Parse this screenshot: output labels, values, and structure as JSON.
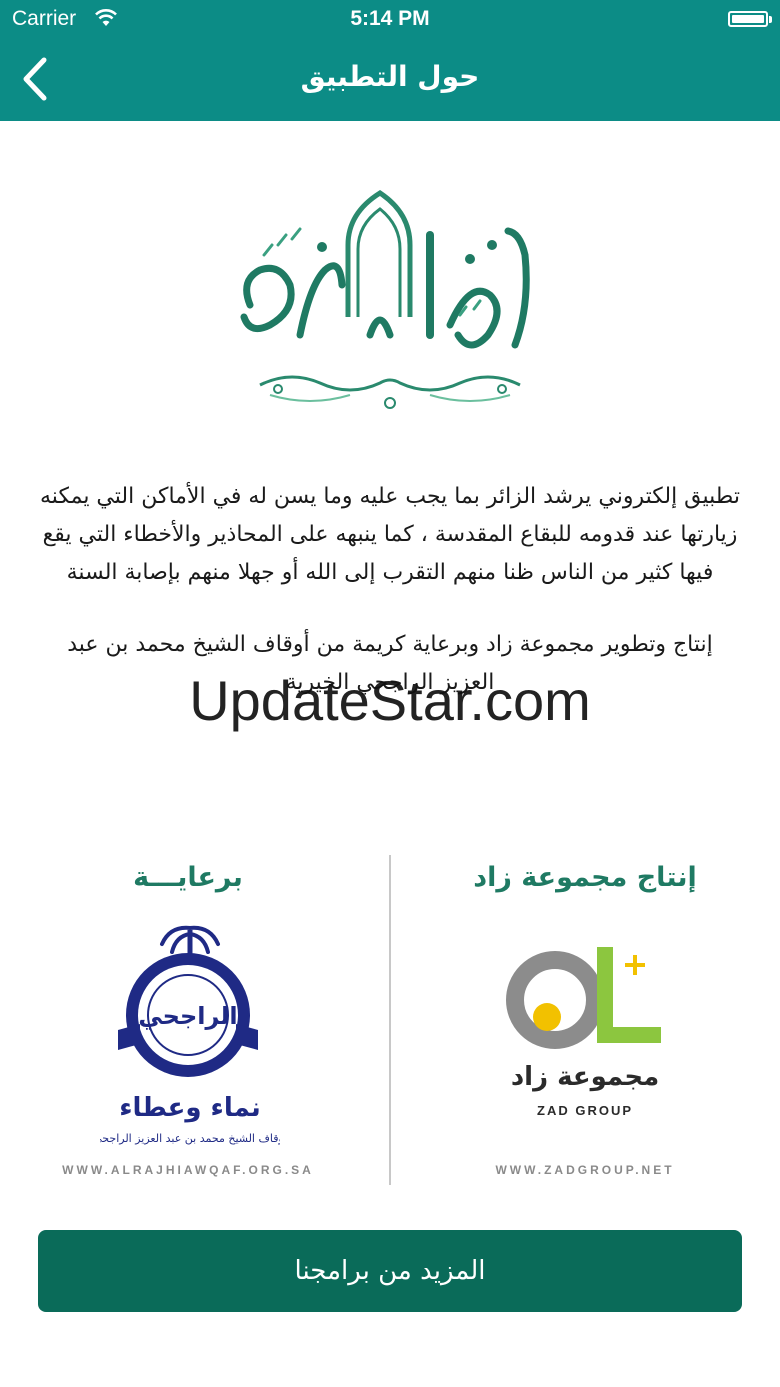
{
  "status_bar": {
    "carrier": "Carrier",
    "time": "5:14 PM"
  },
  "nav": {
    "title": "حول التطبيق",
    "back_icon": "chevron-left-icon"
  },
  "logo": {
    "text": "زيارة الحرم"
  },
  "description": {
    "intro": "تطبيق إلكتروني يرشد الزائر بما يجب عليه وما يسن له في الأماكن التي يمكنه زيارتها عند قدومه للبقاع المقدسة ، كما ينبهه على المحاذير والأخطاء التي يقع فيها كثير من الناس ظنا منهم التقرب إلى الله أو جهلا منهم بإصابة السنة",
    "credits": "إنتاج وتطوير مجموعة زاد وبرعاية كريمة من أوقاف الشيخ محمد بن عبد العزيز الراجحي الخيرية"
  },
  "watermark": "UpdateStar.com",
  "sponsor": {
    "title": "برعايـــة",
    "logo_name": "الراجحي",
    "tagline": "نماء وعطاء",
    "subtitle": "أوقاف الشيخ محمد بن عبد العزيز الراجحي",
    "url": "WWW.ALRAJHIAWQAF.ORG.SA"
  },
  "producer": {
    "title": "إنتاج مجموعة زاد",
    "logo_arabic": "مجموعة زاد",
    "logo_english": "ZAD GROUP",
    "url": "WWW.ZADGROUP.NET"
  },
  "more_button": {
    "label": "المزيد من برامجنا"
  },
  "colors": {
    "primary": "#0c8c86",
    "button": "#0a6b59",
    "logo_green": "#1f7a63",
    "sponsor_blue": "#1f2a85"
  }
}
